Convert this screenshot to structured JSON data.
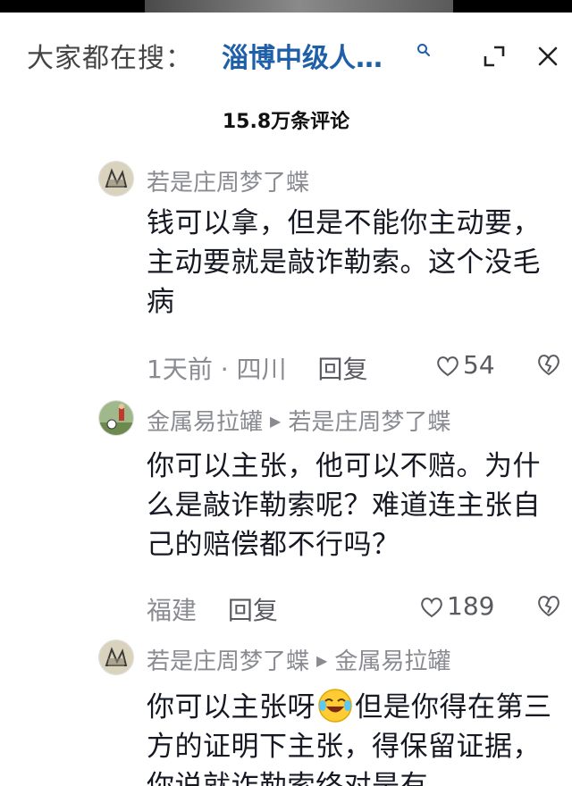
{
  "header": {
    "search_prefix": "大家都在搜：",
    "search_term": "淄博中级人…",
    "icons": [
      "search-icon",
      "expand-icon",
      "close-icon"
    ]
  },
  "comment_count": "15.8万条评论",
  "comments": [
    {
      "author": "若是庄周梦了蝶",
      "reply_to": "",
      "text": "钱可以拿，但是不能你主动要，主动要就是敲诈勒索。这个没毛病",
      "meta": "1天前 · 四川",
      "reply_label": "回复",
      "likes": "54"
    },
    {
      "author": "金属易拉罐",
      "reply_to": "若是庄周梦了蝶",
      "text": "你可以主张，他可以不赔。为什么是敲诈勒索呢？难道连主张自己的赔偿都不行吗？",
      "meta": "福建",
      "reply_label": "回复",
      "likes": "189"
    },
    {
      "author": "若是庄周梦了蝶",
      "reply_to": "金属易拉罐",
      "text_before_emoji": "你可以主张呀",
      "emoji": "laughing-tears-emoji",
      "text_after_emoji": "但是你得在第三方的证明下主张，得保留证据，你说就诈勒索终对是有"
    }
  ]
}
